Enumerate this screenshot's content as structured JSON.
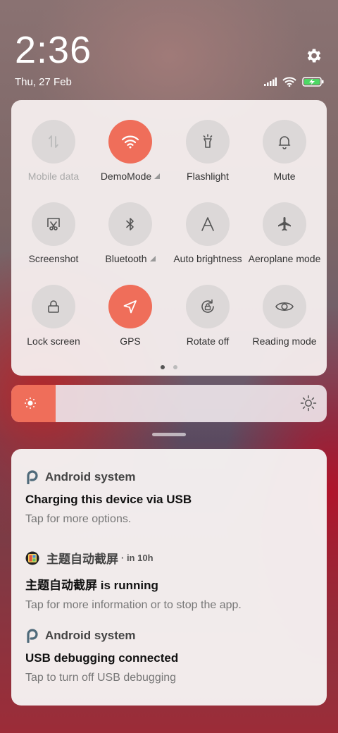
{
  "status_bar": {
    "time": "2:36",
    "date": "Thu, 27 Feb",
    "icons": [
      "signal-icon",
      "wifi-icon",
      "battery-charging-icon"
    ],
    "settings_icon": "gear-icon"
  },
  "quick_settings": {
    "tiles": [
      {
        "label": "Mobile data",
        "icon": "mobile-data-icon",
        "active": false,
        "disabled": true,
        "expandable": false
      },
      {
        "label": "DemoMode",
        "icon": "wifi-icon",
        "active": true,
        "disabled": false,
        "expandable": true
      },
      {
        "label": "Flashlight",
        "icon": "flashlight-icon",
        "active": false,
        "disabled": false,
        "expandable": false
      },
      {
        "label": "Mute",
        "icon": "bell-icon",
        "active": false,
        "disabled": false,
        "expandable": false
      },
      {
        "label": "Screenshot",
        "icon": "screenshot-icon",
        "active": false,
        "disabled": false,
        "expandable": false
      },
      {
        "label": "Bluetooth",
        "icon": "bluetooth-icon",
        "active": false,
        "disabled": false,
        "expandable": true
      },
      {
        "label": "Auto brightness",
        "icon": "auto-brightness-icon",
        "active": false,
        "disabled": false,
        "expandable": false
      },
      {
        "label": "Aeroplane mode",
        "icon": "airplane-icon",
        "active": false,
        "disabled": false,
        "expandable": false
      },
      {
        "label": "Lock screen",
        "icon": "lock-icon",
        "active": false,
        "disabled": false,
        "expandable": false
      },
      {
        "label": "GPS",
        "icon": "location-arrow-icon",
        "active": true,
        "disabled": false,
        "expandable": false
      },
      {
        "label": "Rotate off",
        "icon": "rotate-lock-icon",
        "active": false,
        "disabled": false,
        "expandable": false
      },
      {
        "label": "Reading mode",
        "icon": "eye-icon",
        "active": false,
        "disabled": false,
        "expandable": false
      }
    ],
    "pages": 2,
    "current_page": 1
  },
  "brightness": {
    "level": 0.14,
    "low_icon": "brightness-low-icon",
    "high_icon": "brightness-high-icon"
  },
  "notifications": [
    {
      "app": "Android system",
      "time": "",
      "title": "Charging this device via USB",
      "text": "Tap for more options.",
      "icon": "android-system-icon"
    },
    {
      "app": "主题自动截屏",
      "time": "· in 10h",
      "title": "主题自动截屏 is running",
      "text": "Tap for more information or to stop the app.",
      "icon": "app-thumbnail-icon"
    },
    {
      "app": "Android system",
      "time": "",
      "title": "USB debugging connected",
      "text": "Tap to turn off USB debugging",
      "icon": "android-system-icon"
    }
  ],
  "colors": {
    "accent": "#ef6e5a",
    "tile_inactive": "#dcd8d8",
    "panel_bg": "#f6f0f0"
  }
}
